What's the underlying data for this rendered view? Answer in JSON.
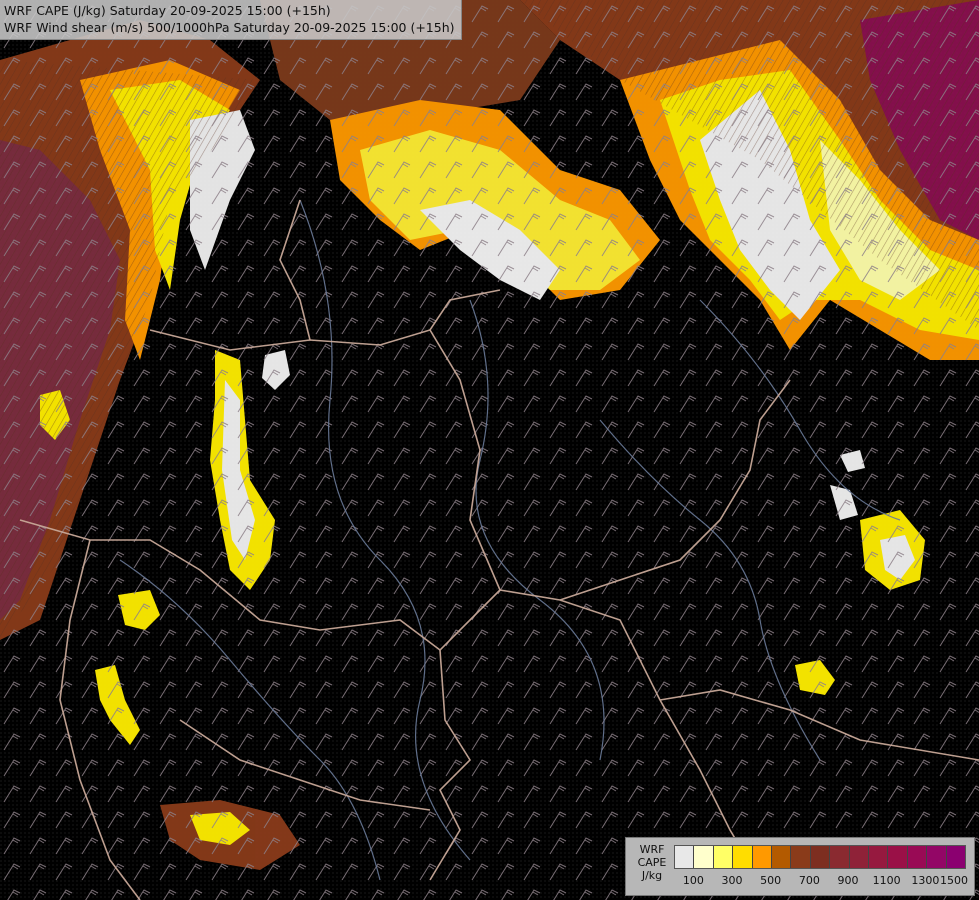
{
  "header": {
    "line1": "WRF CAPE (J/kg) Saturday 20-09-2025 15:00 (+15h)",
    "line2": "WRF Wind shear (m/s) 500/1000hPa Saturday 20-09-2025 15:00 (+15h)"
  },
  "legend": {
    "label_line1": "WRF",
    "label_line2": "CAPE",
    "label_line3": "J/kg",
    "colors": [
      "#e8e8e8",
      "#ffffcc",
      "#ffff66",
      "#ffdd00",
      "#ff9900",
      "#b35a00",
      "#8a3b1a",
      "#7d2e20",
      "#8a2a30",
      "#8f2238",
      "#96193f",
      "#9a1047",
      "#990a55",
      "#930666",
      "#8b0070"
    ],
    "ticks": [
      "100",
      "300",
      "500",
      "700",
      "900",
      "1100",
      "1300",
      "1500"
    ]
  },
  "map": {
    "background_color": "#000000",
    "border_color": "#c8a898",
    "river_color": "#6a7a98",
    "barb_color": "#9a8c92"
  }
}
